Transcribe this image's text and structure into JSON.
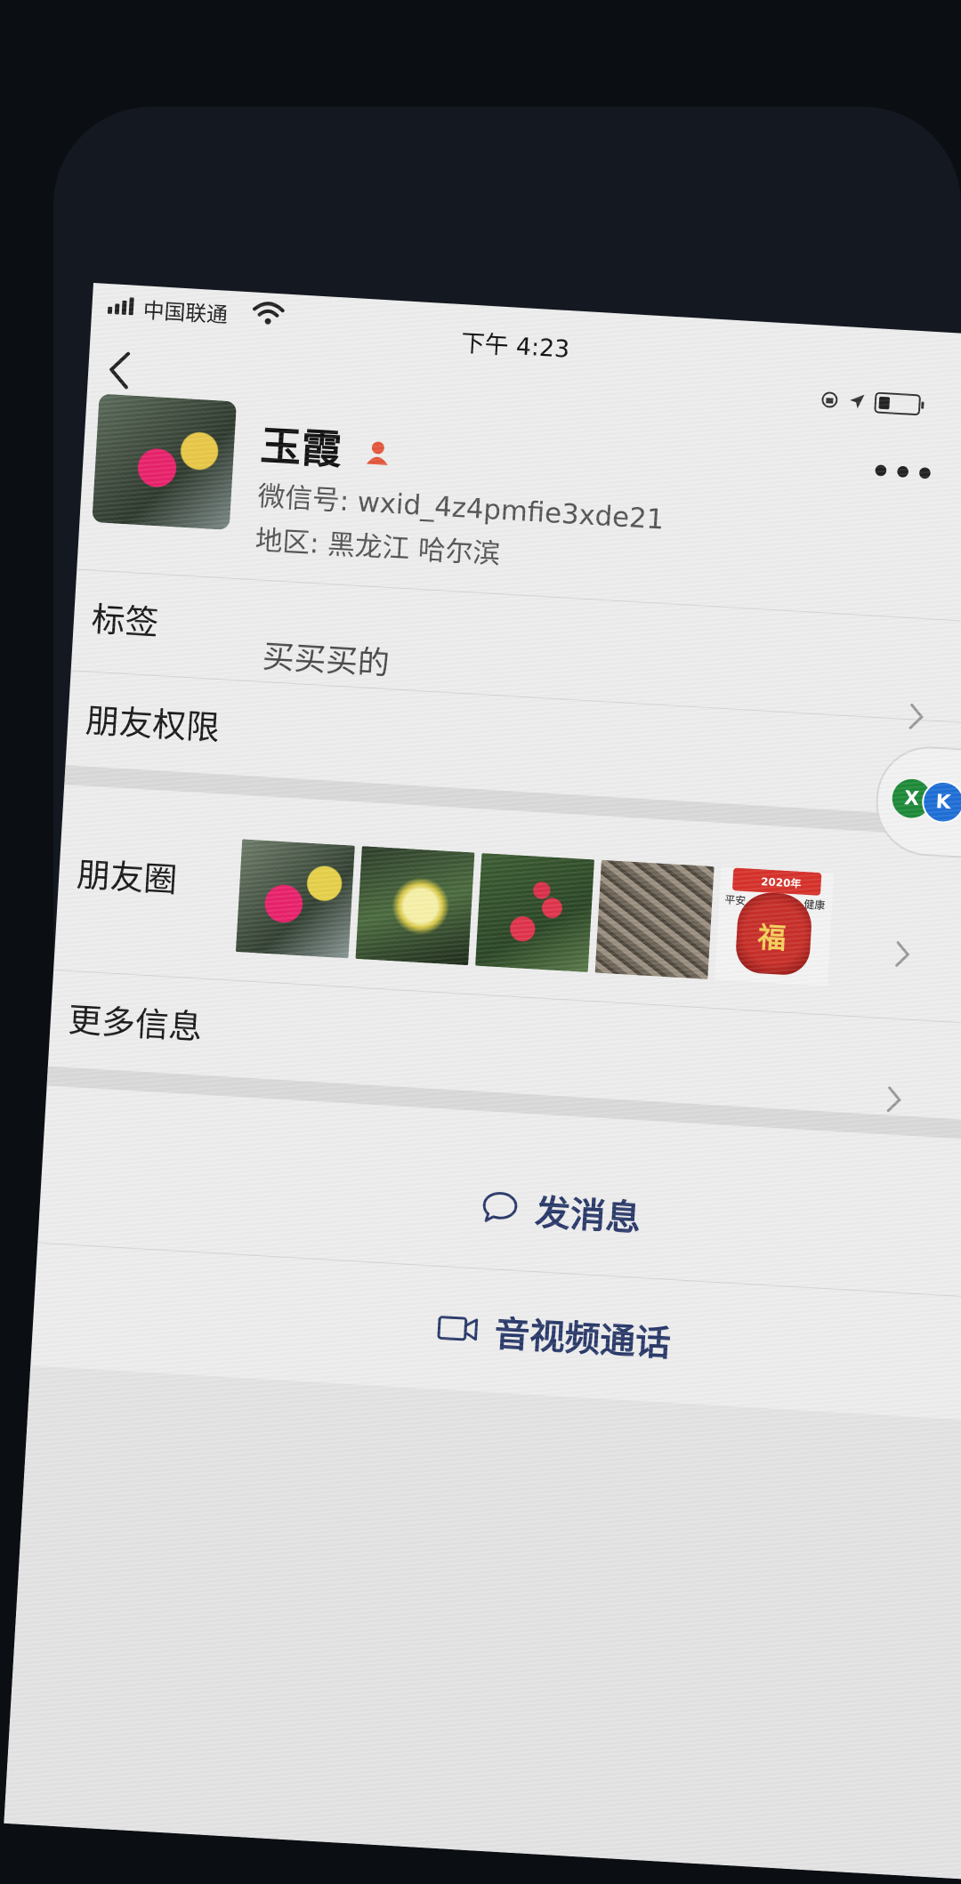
{
  "status_bar": {
    "carrier": "中国联通",
    "time": "下午 4:23"
  },
  "profile": {
    "name": "玉霞",
    "wechat_id": "微信号: wxid_4z4pmfie3xde21",
    "region": "地区: 黑龙江 哈尔滨"
  },
  "rows": {
    "tags_label": "标签",
    "tags_value": "买买买的",
    "friend_permissions": "朋友权限",
    "moments": "朋友圈",
    "more_info": "更多信息"
  },
  "moments_thumbs": {
    "thumb5_year": "2020年",
    "thumb5_char": "福",
    "thumb5_left": "平安",
    "thumb5_right": "健康"
  },
  "floating_bubble": {
    "x_label": "X",
    "k_label": "K"
  },
  "actions": {
    "send_message": "发消息",
    "video_call": "音视频通话"
  },
  "colors": {
    "action_text": "#2a3a6a",
    "page_bg": "#ededed",
    "badge": "#e4573c"
  },
  "icons": {
    "back": "back-chevron-icon",
    "more": "more-dots-icon",
    "badge": "person-badge-icon",
    "chat": "chat-bubble-icon",
    "video": "video-camera-icon"
  }
}
